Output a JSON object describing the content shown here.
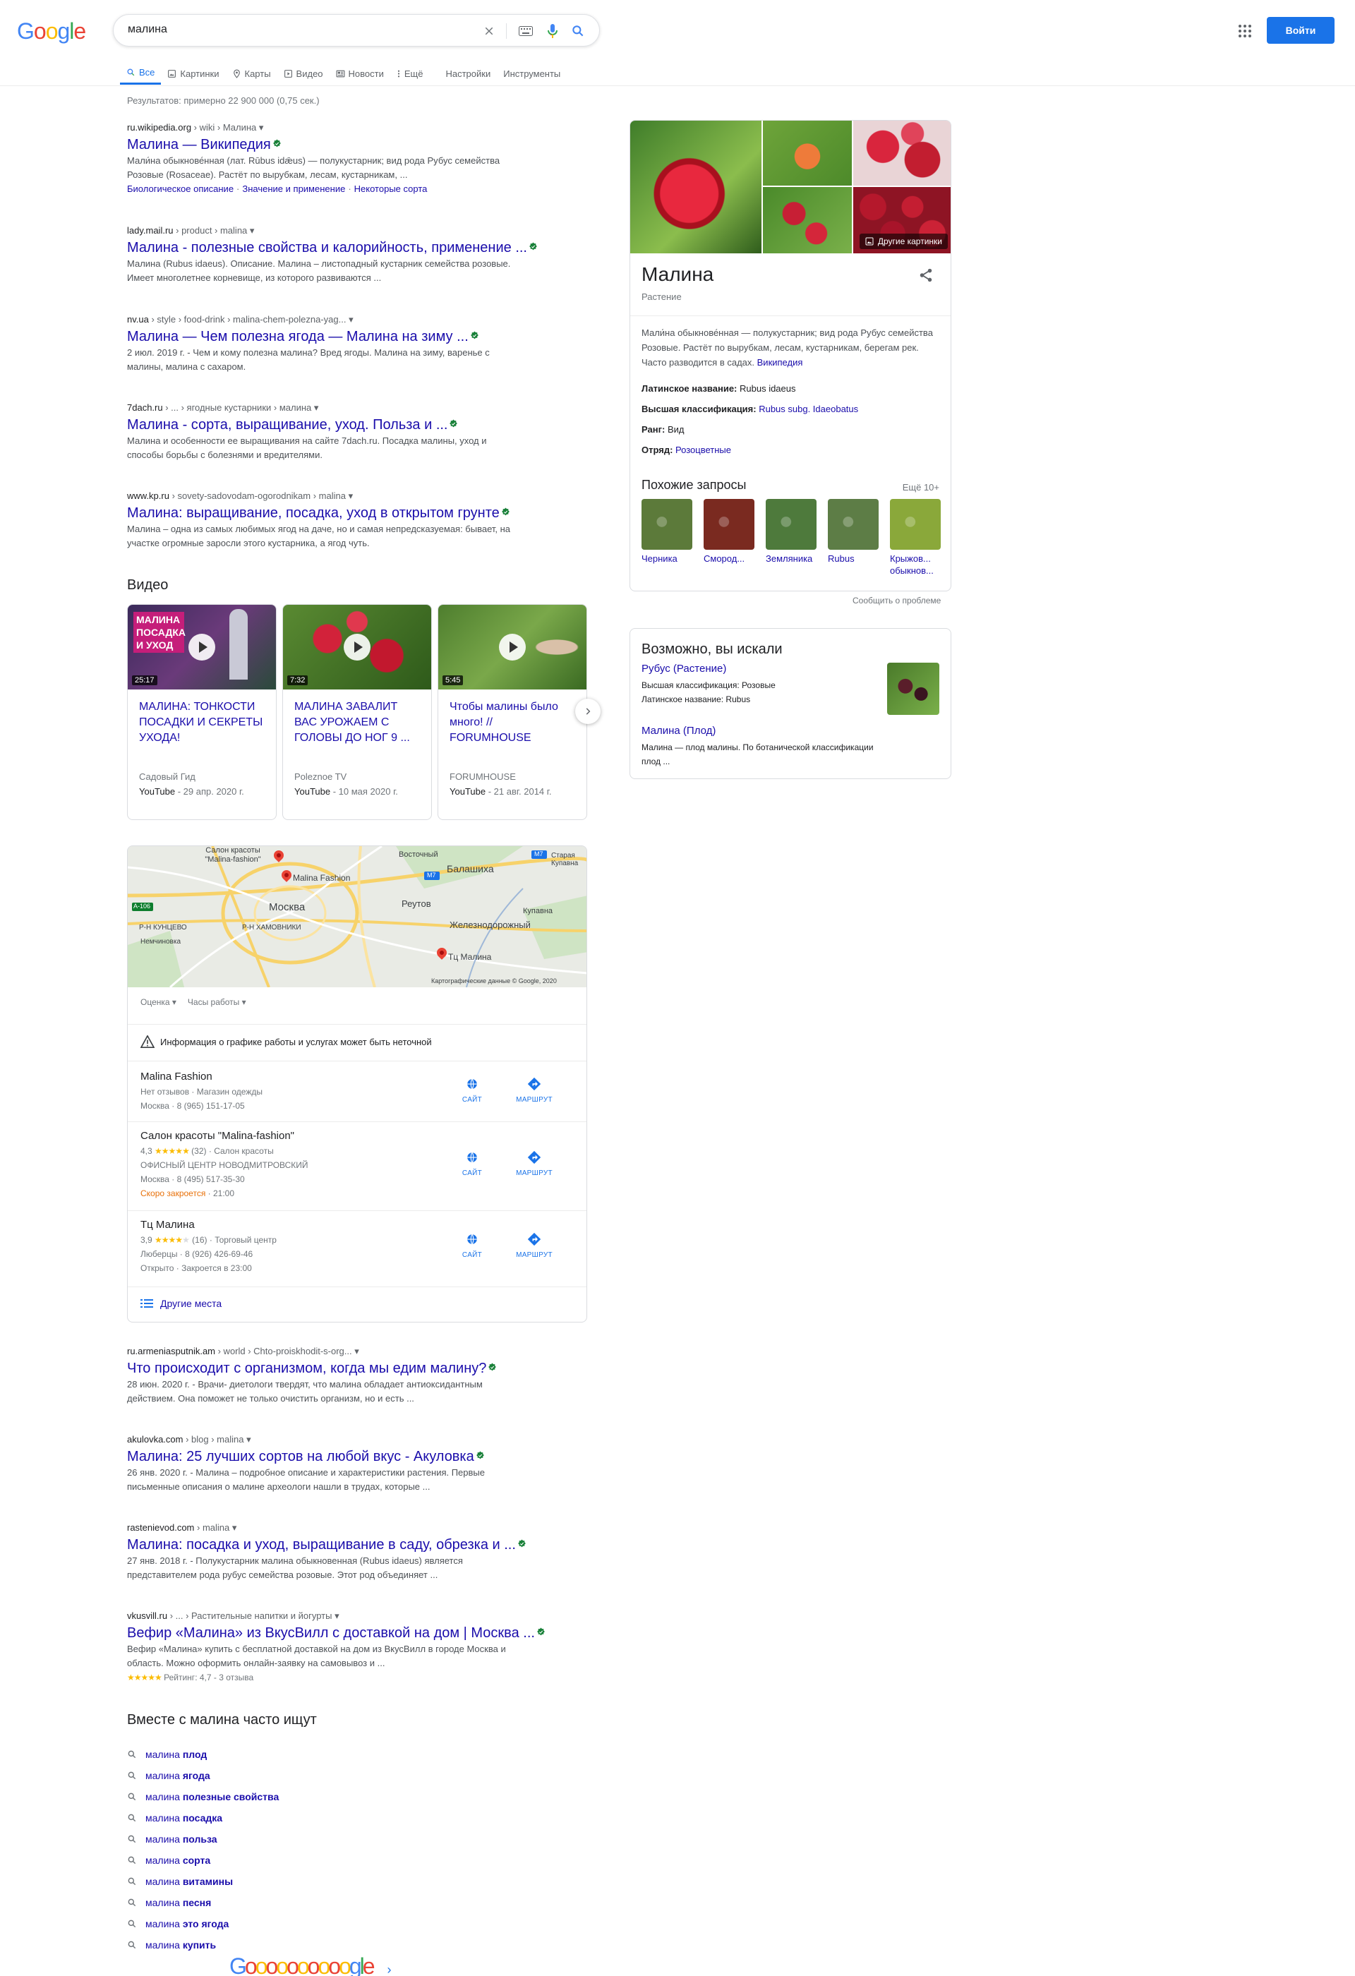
{
  "header": {
    "logo": "Google",
    "query": "малина",
    "signin_label": "Войти"
  },
  "tabs": [
    {
      "label": "Все",
      "icon": "search-icon",
      "active": true
    },
    {
      "label": "Картинки",
      "icon": "image-icon"
    },
    {
      "label": "Карты",
      "icon": "map-pin-icon"
    },
    {
      "label": "Видео",
      "icon": "video-icon"
    },
    {
      "label": "Новости",
      "icon": "news-icon"
    },
    {
      "label": "Ещё",
      "icon": "more-vert-icon"
    },
    {
      "label": "Настройки"
    },
    {
      "label": "Инструменты"
    }
  ],
  "stats": "Результатов: примерно 22 900 000 (0,75 сек.)",
  "results_top": [
    {
      "site": "ru.wikipedia.org",
      "path": " › wiki › Малина",
      "title": "Малина — Википедия",
      "snippet_1": "Мали́на обыкнове́нная (лат. Rūbus idǣus) — полукустарник; вид рода Рубус семейства",
      "snippet_2": "Розовые (Rosaceae). Растёт по вырубкам, лесам, кустарникам, ...",
      "sitelinks": [
        "Биологическое описание",
        "Значение и применение",
        "Некоторые сорта"
      ]
    },
    {
      "site": "lady.mail.ru",
      "path": " › product › malina",
      "title": "Малина - полезные свойства и калорийность, применение ...",
      "snippet_1": "Малина (Rubus idaeus). Описание. Малина – листопадный кустарник семейства розовые.",
      "snippet_2": "Имеет многолетнее корневище, из которого развиваются ..."
    },
    {
      "site": "nv.ua",
      "path": " › style › food-drink › malina-chem-polezna-yag...",
      "title": "Малина — Чем полезна ягода — Малина на зиму ...",
      "snippet_1": "2 июл. 2019 г. - Чем и кому полезна малина? Вред ягоды. Малина на зиму, варенье с",
      "snippet_2": "малины, малина с сахаром."
    },
    {
      "site": "7dach.ru",
      "path": " › ... › ягодные кустарники › малина",
      "title": "Малина - сорта, выращивание, уход. Польза и ...",
      "snippet_1": "Малина и особенности ее выращивания на сайте 7dach.ru. Посадка малины, уход и",
      "snippet_2": "способы борьбы с болезнями и вредителями."
    },
    {
      "site": "www.kp.ru",
      "path": " › sovety-sadovodam-ogorodnikam › malina",
      "title": "Малина: выращивание, посадка, уход в открытом грунте",
      "snippet_1": "Малина – одна из самых любимых ягод на даче, но и самая непредсказуемая: бывает, на",
      "snippet_2": "участке огромные заросли этого кустарника, а ягод чуть."
    }
  ],
  "videos": {
    "heading": "Видео",
    "items": [
      {
        "title": "МАЛИНА: ТОНКОСТИ ПОСАДКИ И СЕКРЕТЫ УХОДА!",
        "duration": "25:17",
        "thumb_text": "МАЛИНА ПОСАДКА И УХОД",
        "channel": "Садовый Гид",
        "source": "YouTube",
        "date": " - 29 апр. 2020 г."
      },
      {
        "title": "МАЛИНА ЗАВАЛИТ ВАС УРОЖАЕМ С ГОЛОВЫ ДО НОГ 9 ...",
        "duration": "7:32",
        "channel": "Poleznoe TV",
        "source": "YouTube",
        "date": " - 10 мая 2020 г."
      },
      {
        "title": "Чтобы малины было много! // FORUMHOUSE",
        "duration": "5:45",
        "channel": "FORUMHOUSE",
        "source": "YouTube",
        "date": " - 21 авг. 2014 г."
      }
    ]
  },
  "map": {
    "labels": {
      "salon": "Салон красоты \"Malina-fashion\"",
      "fashion": "Malina Fashion",
      "moscow": "Москва",
      "vostochny": "Восточный",
      "balashikha": "Балашиха",
      "reutov": "Реутов",
      "kupavna": "Купавна",
      "zheleznodorozhny": "Железнодорожный",
      "kuntsevo": "Р-Н КУНЦЕВО",
      "khamovniki": "Р-Н ХАМОВНИКИ",
      "nemchinovka": "Немчиновка",
      "tc": "Тц Малина",
      "staraya": "Старая Купавна",
      "copyright": "Картографические данные © Google, 2020",
      "a106": "А-106",
      "m7a": "M7",
      "m7b": "M7"
    },
    "filters": [
      "Оценка",
      "Часы работы"
    ],
    "warning": "Информация о графике работы и услугах может быть неточной",
    "site_label": "САЙТ",
    "route_label": "МАРШРУТ",
    "more_places": "Другие места",
    "places": [
      {
        "name": "Malina Fashion",
        "line_1": "Нет отзывов · Магазин одежды",
        "line_2": "Москва · 8 (965) 151-17-05"
      },
      {
        "name": "Салон красоты \"Malina-fashion\"",
        "rating": "4,3",
        "stars": "★★★★★",
        "count": "(32)",
        "category": "Салон красоты",
        "line_1": "ОФИСНЫЙ ЦЕНТР НОВОДМИТРОВСКИЙ",
        "line_2": "Москва · 8 (495) 517-35-30",
        "hours_status": "Скоро закроется",
        "hours": " · 21:00"
      },
      {
        "name": "Тц Малина",
        "rating": "3,9",
        "stars": "★★★★",
        "stars_empty": "★",
        "count": "(16)",
        "category": "Торговый центр",
        "line_2": "Люберцы · 8 (926) 426-69-46",
        "hours_full": "Открыто · Закроется в 23:00"
      }
    ]
  },
  "results_bottom": [
    {
      "site": "ru.armeniasputnik.am",
      "path": " › world › Chto-proiskhodit-s-org...",
      "title": "Что происходит с организмом, когда мы едим малину?",
      "snippet_1": "28 июн. 2020 г. - Врачи- диетологи твердят, что малина обладает антиоксидантным",
      "snippet_2": "действием. Она поможет не только очистить организм, но и есть ..."
    },
    {
      "site": "akulovka.com",
      "path": " › blog › malina",
      "title": "Малина: 25 лучших сортов на любой вкус - Акуловка",
      "snippet_1": "26 янв. 2020 г. - Малина – подробное описание и характеристики растения. Первые",
      "snippet_2": "письменные описания о малине археологи нашли в трудах, которые ..."
    },
    {
      "site": "rastenievod.com",
      "path": " › malina",
      "title": "Малина: посадка и уход, выращивание в саду, обрезка и ...",
      "snippet_1": "27 янв. 2018 г. - Полукустарник малина обыкновенная (Rubus idaeus) является",
      "snippet_2": "представителем рода рубус семейства розовые. Этот род объединяет ..."
    },
    {
      "site": "vkusvill.ru",
      "path": " › ... › Растительные напитки и йогурты",
      "title": "Вефир «Малина» из ВкусВилл с доставкой на дом | Москва ...",
      "snippet_1": "Вефир «Малина» купить с бесплатной доставкой на дом из ВкусВилл в городе Москва и",
      "snippet_2": "область. Можно оформить онлайн-заявку на самовывоз и ...",
      "rating_stars": "★★★★★",
      "rating_text": " Рейтинг: 4,7 - 3 отзыва"
    }
  ],
  "related": {
    "heading": "Вместе с малина часто ищут",
    "prefix": "малина",
    "items": [
      "плод",
      "ягода",
      "полезные свойства",
      "посадка",
      "польза",
      "сорта",
      "витамины",
      "песня",
      "это ягода",
      "купить"
    ]
  },
  "pager": {
    "text": "Goooooooooogle"
  },
  "knowledge_panel": {
    "more_images": "Другие картинки",
    "title": "Малина",
    "subtitle": "Растение",
    "desc": "Мали́на обыкнове́нная — полукустарник; вид рода Рубус семейства Розовые. Растёт по вырубкам, лесам, кустарникам, берегам рек. Часто разводится в садах.",
    "desc_link": "Википедия",
    "facts": [
      {
        "label": "Латинское название:",
        "value": " Rubus idaeus"
      },
      {
        "label": "Высшая классификация:",
        "value": " Rubus subg. Idaeobatus"
      },
      {
        "label": "Ранг:",
        "value": " Вид"
      },
      {
        "label": "Отряд:",
        "value": " Розоцветные"
      }
    ],
    "similar_heading": "Похожие запросы",
    "similar_more": "Ещё 10+",
    "similar": [
      {
        "label": "Черника",
        "color": "#5c7a3a"
      },
      {
        "label": "Смород...",
        "color": "#7a2a20"
      },
      {
        "label": "Земляника",
        "color": "#4e7a3c"
      },
      {
        "label": "Rubus",
        "color": "#5d7d46"
      },
      {
        "label": "Крыжов... обыкнов...",
        "color": "#8aa83a"
      }
    ],
    "feedback": "Сообщить о проблеме"
  },
  "did_you_mean": {
    "heading": "Возможно, вы искали",
    "item_1_title": "Рубус (Растение)",
    "item_1_line_1": "Высшая классификация: Розовые",
    "item_1_line_2": "Латинское название: Rubus",
    "item_2_title": "Малина (Плод)",
    "item_2_line_1": "Малина — плод малины. По ботанической классификации",
    "item_2_line_2": "плод ..."
  },
  "colors": {
    "link": "#1a0dab",
    "accent": "#1a73e8",
    "raspberry": "#c8102e"
  }
}
